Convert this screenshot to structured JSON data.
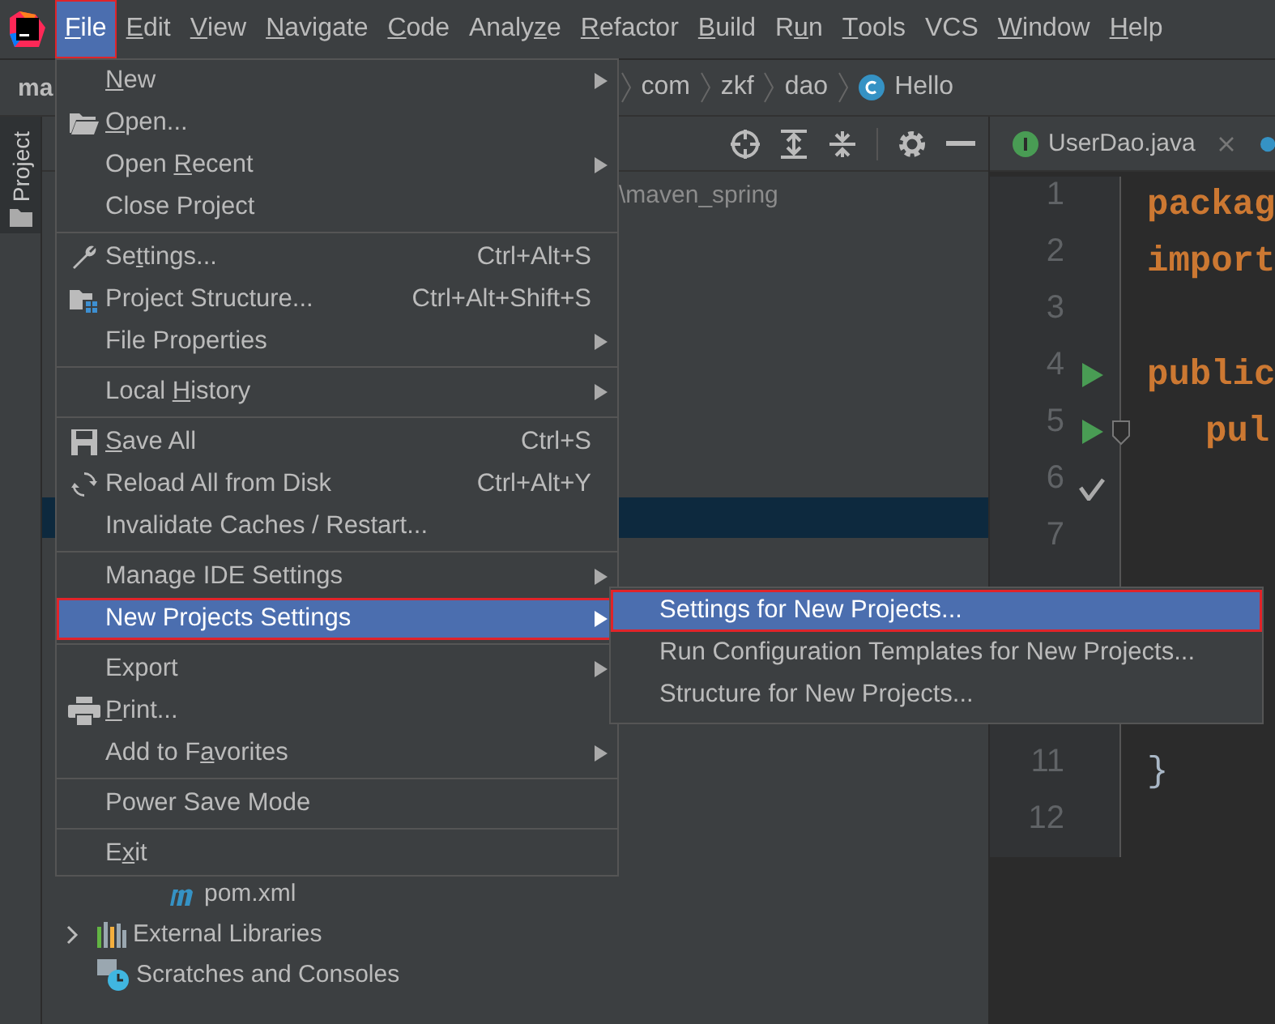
{
  "menubar": [
    {
      "key": "F",
      "after": "ile",
      "selected": true,
      "annotated": true
    },
    {
      "key": "E",
      "after": "dit",
      "selected": false,
      "annotated": false
    },
    {
      "key": "V",
      "after": "iew",
      "selected": false,
      "annotated": false
    },
    {
      "key": "N",
      "after": "avigate",
      "selected": false,
      "annotated": false
    },
    {
      "key": "C",
      "after": "ode",
      "selected": false,
      "annotated": false
    },
    {
      "before": "Analy",
      "key": "z",
      "after": "e",
      "selected": false,
      "annotated": false
    },
    {
      "key": "R",
      "after": "efactor",
      "selected": false,
      "annotated": false
    },
    {
      "key": "B",
      "after": "uild",
      "selected": false,
      "annotated": false
    },
    {
      "before": "R",
      "key": "u",
      "after": "n",
      "selected": false,
      "annotated": false
    },
    {
      "key": "T",
      "after": "ools",
      "selected": false,
      "annotated": false
    },
    {
      "before": "VCS",
      "selected": false,
      "annotated": false
    },
    {
      "key": "W",
      "after": "indow",
      "selected": false,
      "annotated": false
    },
    {
      "key": "H",
      "after": "elp",
      "selected": false,
      "annotated": false
    }
  ],
  "breadcrumb": {
    "project": "ma",
    "items": [
      "com",
      "zkf",
      "dao",
      "Hello"
    ]
  },
  "left_strip": {
    "tab": "Project"
  },
  "project_panel": {
    "path": "\\maven_spring",
    "tree": [
      {
        "label": "pom.xml",
        "kind": "maven",
        "expandable": false
      },
      {
        "label": "External Libraries",
        "kind": "libraries",
        "expandable": true
      },
      {
        "label": "Scratches and Consoles",
        "kind": "scratches",
        "expandable": false
      }
    ]
  },
  "editor": {
    "tab": {
      "label": "UserDao.java"
    },
    "lines": [
      {
        "number": "1",
        "kind": "plain",
        "code": "packag",
        "keyword": true
      },
      {
        "number": "2",
        "kind": "plain",
        "code": "import",
        "keyword": true
      },
      {
        "number": "3",
        "kind": "plain"
      },
      {
        "number": "4",
        "kind": "run",
        "code": "public",
        "keyword": true
      },
      {
        "number": "5",
        "kind": "run",
        "fold": true,
        "code": "pul",
        "keyword": true,
        "indent": true
      },
      {
        "number": "6",
        "kind": "check"
      },
      {
        "number": "7",
        "kind": "plain"
      },
      {
        "kind": "plain"
      },
      {
        "kind": "plain"
      },
      {
        "kind": "plain"
      },
      {
        "number": "11",
        "kind": "plain",
        "code": "}",
        "keyword": false
      },
      {
        "number": "12",
        "kind": "plain"
      }
    ]
  },
  "file_menu": [
    {
      "kind": "item",
      "key": "N",
      "after": "ew",
      "submenu": true,
      "selected": false,
      "annotated": false
    },
    {
      "kind": "item",
      "key": "O",
      "after": "pen...",
      "selected": false,
      "annotated": false
    },
    {
      "kind": "item",
      "before": "Open ",
      "key": "R",
      "after": "ecent",
      "submenu": true,
      "selected": false,
      "annotated": false
    },
    {
      "kind": "item",
      "before": "Close Project",
      "selected": false,
      "annotated": false
    },
    {
      "kind": "separator"
    },
    {
      "kind": "item",
      "before": "Se",
      "key": "t",
      "after": "tings...",
      "shortcut": "Ctrl+Alt+S",
      "selected": false,
      "annotated": false
    },
    {
      "kind": "item",
      "before": "Project Structure...",
      "shortcut": "Ctrl+Alt+Shift+S",
      "selected": false,
      "annotated": false
    },
    {
      "kind": "item",
      "before": "File Properties",
      "submenu": true,
      "selected": false,
      "annotated": false
    },
    {
      "kind": "separator"
    },
    {
      "kind": "item",
      "before": "Local ",
      "key": "H",
      "after": "istory",
      "submenu": true,
      "selected": false,
      "annotated": false
    },
    {
      "kind": "separator"
    },
    {
      "kind": "item",
      "key": "S",
      "after": "ave All",
      "shortcut": "Ctrl+S",
      "selected": false,
      "annotated": false
    },
    {
      "kind": "item",
      "before": "Reload All from Disk",
      "shortcut": "Ctrl+Alt+Y",
      "selected": false,
      "annotated": false
    },
    {
      "kind": "item",
      "before": "Invalidate Caches / Restart...",
      "selected": false,
      "annotated": false
    },
    {
      "kind": "separator"
    },
    {
      "kind": "item",
      "before": "Manage IDE Settings",
      "submenu": true,
      "selected": false,
      "annotated": false
    },
    {
      "kind": "item",
      "before": "New Projects Settings",
      "submenu": true,
      "selected": true,
      "annotated": true
    },
    {
      "kind": "separator"
    },
    {
      "kind": "item",
      "before": "Export",
      "submenu": true,
      "selected": false,
      "annotated": false
    },
    {
      "kind": "item",
      "key": "P",
      "after": "rint...",
      "selected": false,
      "annotated": false
    },
    {
      "kind": "item",
      "before": "Add to F",
      "key": "a",
      "after": "vorites",
      "submenu": true,
      "selected": false,
      "annotated": false
    },
    {
      "kind": "separator"
    },
    {
      "kind": "item",
      "before": "Power Save Mode",
      "selected": false,
      "annotated": false
    },
    {
      "kind": "separator"
    },
    {
      "kind": "item",
      "before": "E",
      "key": "x",
      "after": "it",
      "selected": false,
      "annotated": false
    }
  ],
  "submenu": [
    {
      "label": "Settings for New Projects...",
      "selected": true,
      "annotated": true
    },
    {
      "label": "Run Configuration Templates for New Projects...",
      "selected": false,
      "annotated": false
    },
    {
      "label": "Structure for New Projects...",
      "selected": false,
      "annotated": false
    }
  ]
}
